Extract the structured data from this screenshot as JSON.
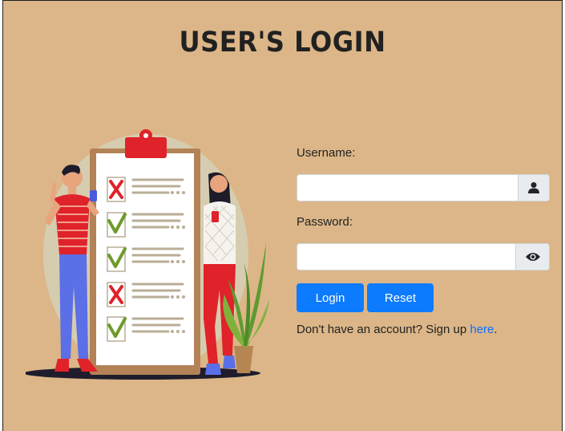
{
  "header": {
    "title": "USER'S LOGIN"
  },
  "form": {
    "username_label": "Username:",
    "username_value": "",
    "password_label": "Password:",
    "password_value": "",
    "login_button": "Login",
    "reset_button": "Reset",
    "signup_prefix": "Don't have an account? Sign up ",
    "signup_link": "here",
    "signup_suffix": "."
  },
  "icons": {
    "username_addon": "user-icon",
    "password_addon": "eye-icon"
  },
  "colors": {
    "background": "#dcb688",
    "button": "#0d7bfe",
    "link": "#0d6efd",
    "title": "#212121"
  }
}
